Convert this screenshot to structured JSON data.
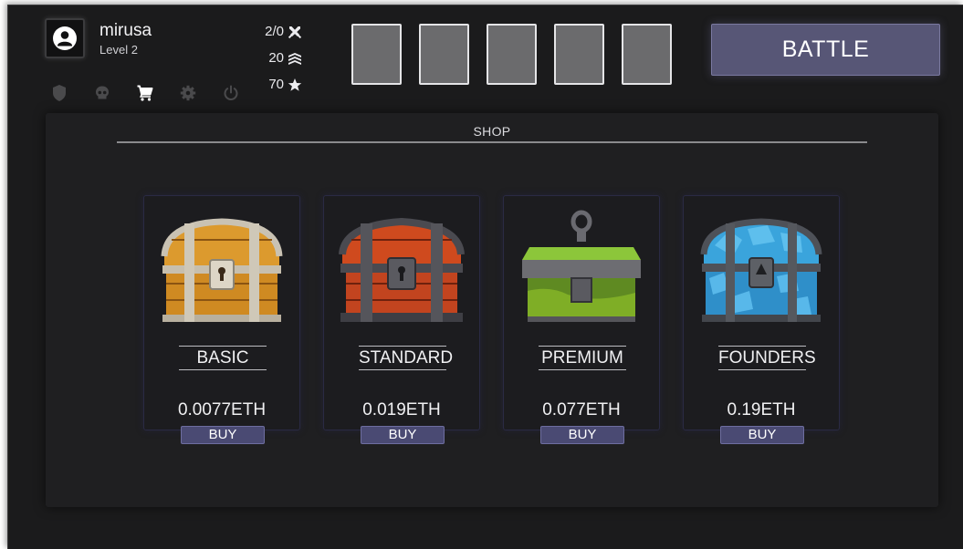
{
  "user": {
    "name": "mirusa",
    "level": "Level 2",
    "avatar_icon": "user-circle-icon"
  },
  "nav": [
    {
      "icon": "shield-icon",
      "active": false
    },
    {
      "icon": "skull-icon",
      "active": false
    },
    {
      "icon": "cart-icon",
      "active": true
    },
    {
      "icon": "gear-icon",
      "active": false
    },
    {
      "icon": "power-icon",
      "active": false
    }
  ],
  "stats": {
    "battles": {
      "value": "2/0",
      "icon": "crossed-swords-icon"
    },
    "rank": {
      "value": "20",
      "icon": "rank-chevrons-icon"
    },
    "stars": {
      "value": "70",
      "icon": "star-icon"
    }
  },
  "slots_count": 5,
  "battle_button": {
    "label": "BATTLE"
  },
  "shop": {
    "title": "SHOP",
    "chests": [
      {
        "name": "BASIC",
        "price": "0.0077ETH",
        "buy_label": "BUY",
        "color": "#d9962a"
      },
      {
        "name": "STANDARD",
        "price": "0.019ETH",
        "buy_label": "BUY",
        "color": "#c2441f"
      },
      {
        "name": "PREMIUM",
        "price": "0.077ETH",
        "buy_label": "BUY",
        "color": "#7fae26"
      },
      {
        "name": "FOUNDERS",
        "price": "0.19ETH",
        "buy_label": "BUY",
        "color": "#2f8fc9"
      }
    ]
  },
  "colors": {
    "accent": "#575676",
    "background": "#1b1b1c",
    "panel": "#1f1f21"
  }
}
